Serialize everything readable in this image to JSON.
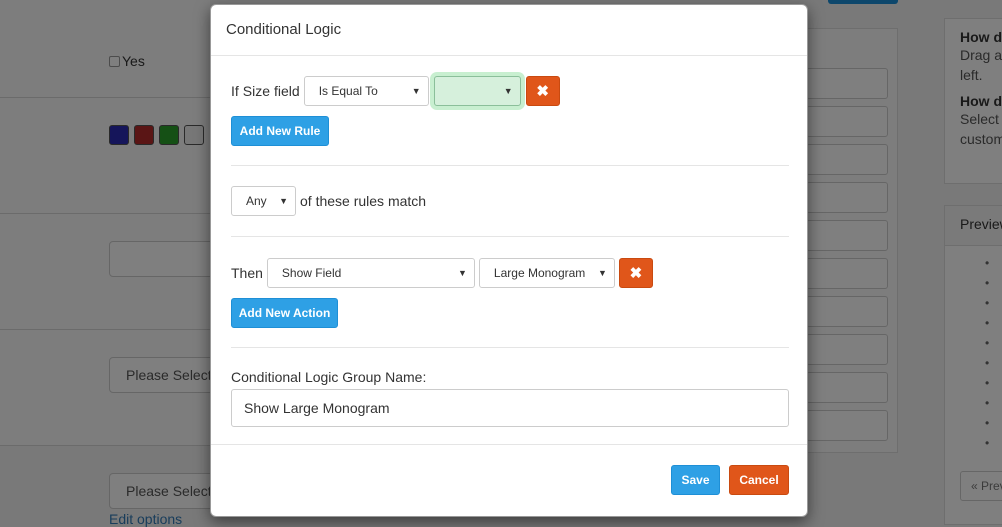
{
  "background": {
    "yes_label": "Yes",
    "swatch_colors": [
      "#2b2bb5",
      "#b52b2b",
      "#2ba02b",
      "#eeeeee"
    ],
    "select_placeholder_1": "Please Select",
    "select_placeholder_2": "Please Select",
    "edit_options_link": "Edit options",
    "right_panel": {
      "heading_1": "How do",
      "text_1a": "Drag a",
      "text_1b": "left.",
      "heading_2": "How do",
      "text_2a": "Select",
      "text_2b": "custom"
    },
    "preview_panel": {
      "heading": "Preview",
      "prev_button": "« Prev"
    }
  },
  "modal": {
    "title": "Conditional Logic",
    "rule": {
      "if_label": "If",
      "field_name": "Size",
      "field_label": "field",
      "operator_value": "Is Equal To",
      "value_select": ""
    },
    "add_rule_label": "Add New Rule",
    "match": {
      "value": "Any",
      "suffix": "of these rules match"
    },
    "action": {
      "then_label": "Then",
      "action_value": "Show Field",
      "target_value": "Large Monogram"
    },
    "add_action_label": "Add New Action",
    "group_name": {
      "label": "Conditional Logic Group Name:",
      "value": "Show Large Monogram"
    },
    "footer": {
      "save_label": "Save",
      "cancel_label": "Cancel"
    }
  },
  "icons": {
    "remove": "✖",
    "caret": "▼"
  },
  "colors": {
    "primary": "#2ea0e5",
    "danger": "#e0561a",
    "highlight": "#d6f0dc"
  }
}
